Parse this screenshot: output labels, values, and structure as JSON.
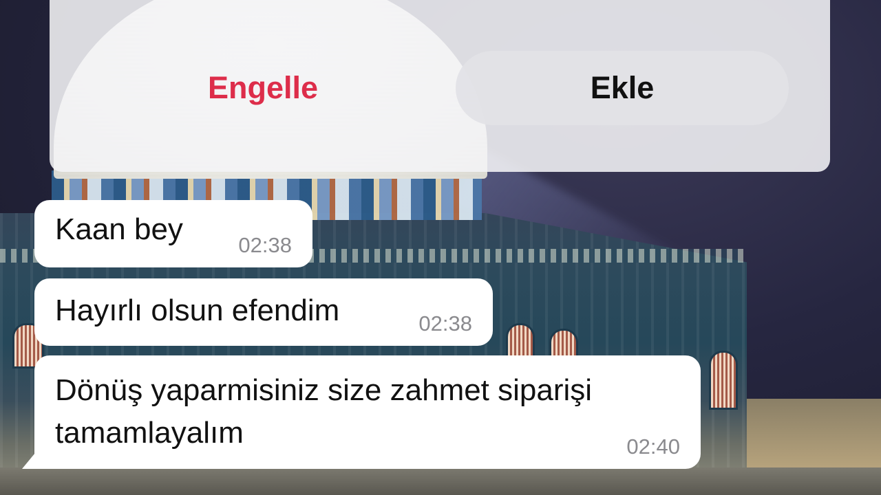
{
  "contact_prompt": {
    "block_label": "Engelle",
    "add_label": "Ekle"
  },
  "messages": [
    {
      "text": "Kaan bey",
      "time": "02:38"
    },
    {
      "text": "Hayırlı olsun efendim",
      "time": "02:38"
    },
    {
      "text": "Dönüş yaparmisiniz size zahmet siparişi tamamlayalım",
      "time": "02:40"
    }
  ],
  "colors": {
    "block_text": "#dd2d4a",
    "bubble_bg": "#ffffff",
    "timestamp": "#8a8a8e",
    "prompt_bg": "#f4f4f6"
  }
}
